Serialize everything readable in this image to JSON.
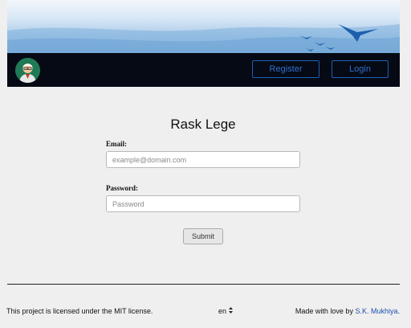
{
  "header": {
    "banner_image": "sky-with-birds",
    "avatar_icon": "user-avatar-icon",
    "register_label": "Register",
    "login_label": "Login"
  },
  "form": {
    "title": "Rask Lege",
    "email_label": "Email:",
    "email_placeholder": "example@domain.com",
    "email_value": "",
    "password_label": "Password:",
    "password_placeholder": "Password",
    "password_value": "",
    "submit_label": "Submit"
  },
  "footer": {
    "license_text": "This project is licensed under the MIT license.",
    "language": "en",
    "language_icon": "up-down-chevron-icon",
    "made_prefix": "Made with love by ",
    "author": "S.K. Mukhiya",
    "made_suffix": "."
  },
  "colors": {
    "navbar": "#060a14",
    "nav_button": "#2f6fd0",
    "link": "#1d4fb0",
    "background": "#efefef"
  }
}
